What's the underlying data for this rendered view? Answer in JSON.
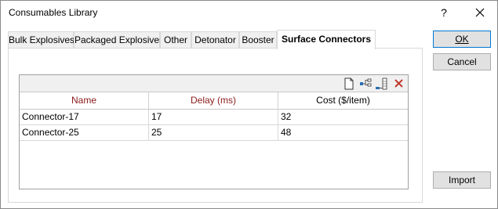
{
  "window": {
    "title": "Consumables Library",
    "help_label": "?"
  },
  "tabs": [
    {
      "label": "Bulk Explosives"
    },
    {
      "label": "Packaged Explosives"
    },
    {
      "label": "Other"
    },
    {
      "label": "Detonator"
    },
    {
      "label": "Booster"
    },
    {
      "label": "Surface Connectors",
      "active": true
    }
  ],
  "grid": {
    "toolbar_icons": [
      "new-row-icon",
      "tree-icon",
      "insert-column-icon",
      "delete-icon"
    ],
    "columns": [
      {
        "label": "Name",
        "required": true
      },
      {
        "label": "Delay (ms)",
        "required": true
      },
      {
        "label": "Cost ($/item)",
        "required": false
      }
    ],
    "rows": [
      [
        "Connector-17",
        "17",
        "32"
      ],
      [
        "Connector-25",
        "25",
        "48"
      ]
    ]
  },
  "buttons": {
    "ok_label": "OK",
    "cancel_label": "Cancel",
    "import_label": "Import"
  },
  "colors": {
    "required_header": "#8b1a1a",
    "delete_icon": "#c0392b",
    "default_button_border": "#0078d7"
  }
}
